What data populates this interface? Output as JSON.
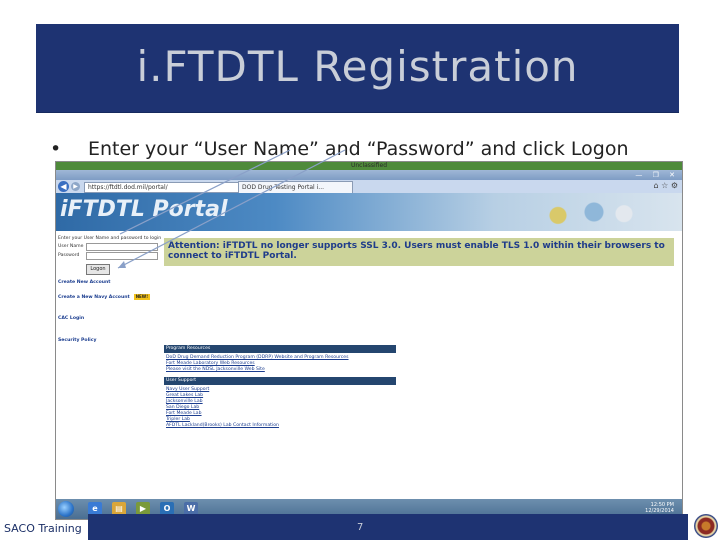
{
  "slide": {
    "title": "i.FTDTL Registration",
    "bullet_symbol": "•",
    "instruction": "Enter your “User Name” and “Password” and click Logon",
    "footer_left": "SACO Training",
    "page_number": "7"
  },
  "screenshot": {
    "classification_banner": "Unclassified",
    "window_buttons": "— ❐ ✕",
    "browser": {
      "back_icon": "back-arrow-icon",
      "url": "https://ftdtl.dod.mil/portal/",
      "tab_title": "DOD Drug Testing Portal i...",
      "toolbar_icons": "⌂ ☆ ⚙"
    },
    "portal": {
      "title": "iFTDTL Portal",
      "login": {
        "prompt": "Enter your User Name and password to login",
        "user_label": "User Name",
        "password_label": "Password",
        "logon_button": "Logon",
        "forgot_link": "Create New Account",
        "new_account_heading": "Create a New Navy Account",
        "new_badge": "NEW!",
        "cac_login": "CAC Login",
        "security_policy": "Security Policy"
      },
      "attention": "Attention: iFTDTL no longer supports SSL 3.0. Users must enable TLS 1.0 within their browsers to connect to iFTDTL Portal.",
      "sections": [
        {
          "heading": "Program Resources",
          "links": [
            "DoD Drug Demand Reduction Program (DDRP) Website and Program Resources",
            "Fort Meade Laboratory Web Resources",
            "Please visit the NDSL Jacksonville Web Site"
          ]
        },
        {
          "heading": "User Support",
          "links": [
            "Navy User Support",
            "Great Lakes Lab",
            "Jacksonville Lab",
            "San Diego Lab",
            "Fort Meade Lab",
            "Tripler Lab",
            "AFDTL Lackland(Brooks) Lab Contact Information"
          ]
        }
      ]
    },
    "taskbar": {
      "clock_time": "12:50 PM",
      "clock_date": "12/29/2014"
    }
  }
}
